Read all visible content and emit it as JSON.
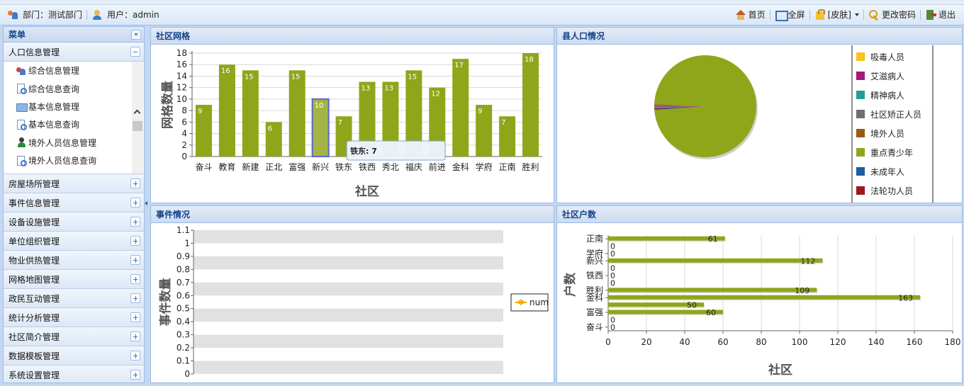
{
  "topbar": {
    "dept_label": "部门：测试部门",
    "user_label": "用户：admin",
    "home": "首页",
    "fullscreen": "全屏",
    "skin": "[皮肤]",
    "change_password": "更改密码",
    "logout": "退出"
  },
  "sidebar": {
    "title": "菜单",
    "expanded_section": "人口信息管理",
    "sub_items": [
      {
        "label": "综合信息管理",
        "icon": "people-icon"
      },
      {
        "label": "综合信息查询",
        "icon": "search-doc-icon"
      },
      {
        "label": "基本信息管理",
        "icon": "folder-icon"
      },
      {
        "label": "基本信息查询",
        "icon": "search-doc-icon"
      },
      {
        "label": "境外人员信息管理",
        "icon": "person-icon"
      },
      {
        "label": "境外人员信息查询",
        "icon": "search-doc-icon"
      }
    ],
    "sections": [
      "房屋场所管理",
      "事件信息管理",
      "设备设施管理",
      "单位组织管理",
      "物业供热管理",
      "网格地图管理",
      "政民互动管理",
      "统计分析管理",
      "社区简介管理",
      "数据模板管理",
      "系统设置管理"
    ]
  },
  "panels": {
    "grid": "社区网格",
    "population": "县人口情况",
    "events": "事件情况",
    "households": "社区户数"
  },
  "chart_data": [
    {
      "type": "bar",
      "categories": [
        "奋斗",
        "教育",
        "新建",
        "正北",
        "富强",
        "新兴",
        "铁东",
        "铁西",
        "秀北",
        "福庆",
        "前进",
        "金科",
        "学府",
        "正南",
        "胜利"
      ],
      "values": [
        9,
        16,
        15,
        6,
        15,
        10,
        7,
        13,
        13,
        15,
        12,
        17,
        9,
        7,
        18
      ],
      "xlabel": "社区",
      "ylabel": "网格数量",
      "ylim": [
        0,
        18
      ],
      "yticks": [
        0,
        2,
        4,
        6,
        8,
        10,
        12,
        14,
        16,
        18
      ],
      "color": "#8fa61a",
      "highlight_index": 5,
      "tooltip": "铁东: 7"
    },
    {
      "type": "pie",
      "labels": [
        "吸毒人员",
        "艾滋病人",
        "精神病人",
        "社区矫正人员",
        "境外人员",
        "重点青少年",
        "未成年人",
        "法轮功人员"
      ],
      "values": [
        0.2,
        0.3,
        0.2,
        0.3,
        0.2,
        98.2,
        0.3,
        0.3
      ],
      "colors": [
        "#f7c31c",
        "#a3187b",
        "#20a090",
        "#6e6e6e",
        "#9a5a16",
        "#8fa61a",
        "#1a5fa0",
        "#a0161e"
      ],
      "legend": "right"
    },
    {
      "type": "bar",
      "categories": [],
      "series": [
        {
          "name": "num",
          "values": []
        }
      ],
      "ylabel": "事件数量",
      "ylim": [
        0,
        1.1
      ],
      "yticks": [
        0,
        0.1,
        0.2,
        0.3,
        0.4,
        0.5,
        0.6,
        0.7,
        0.8,
        0.9,
        1,
        1.1
      ],
      "legend": "right"
    },
    {
      "type": "bar",
      "orientation": "horizontal",
      "categories": [
        "奋斗",
        "",
        "富强",
        "",
        "金科",
        "胜利",
        "",
        "铁西",
        "",
        "新兴",
        "学府",
        "",
        "正南"
      ],
      "values": [
        0,
        0,
        60,
        50,
        163,
        109,
        0,
        0,
        0,
        112,
        0,
        0,
        61
      ],
      "xlabel": "社区",
      "ylabel": "户数",
      "xlim": [
        0,
        180
      ],
      "xticks": [
        0,
        20,
        40,
        60,
        80,
        100,
        120,
        140,
        160,
        180
      ],
      "color": "#8fa61a"
    }
  ]
}
